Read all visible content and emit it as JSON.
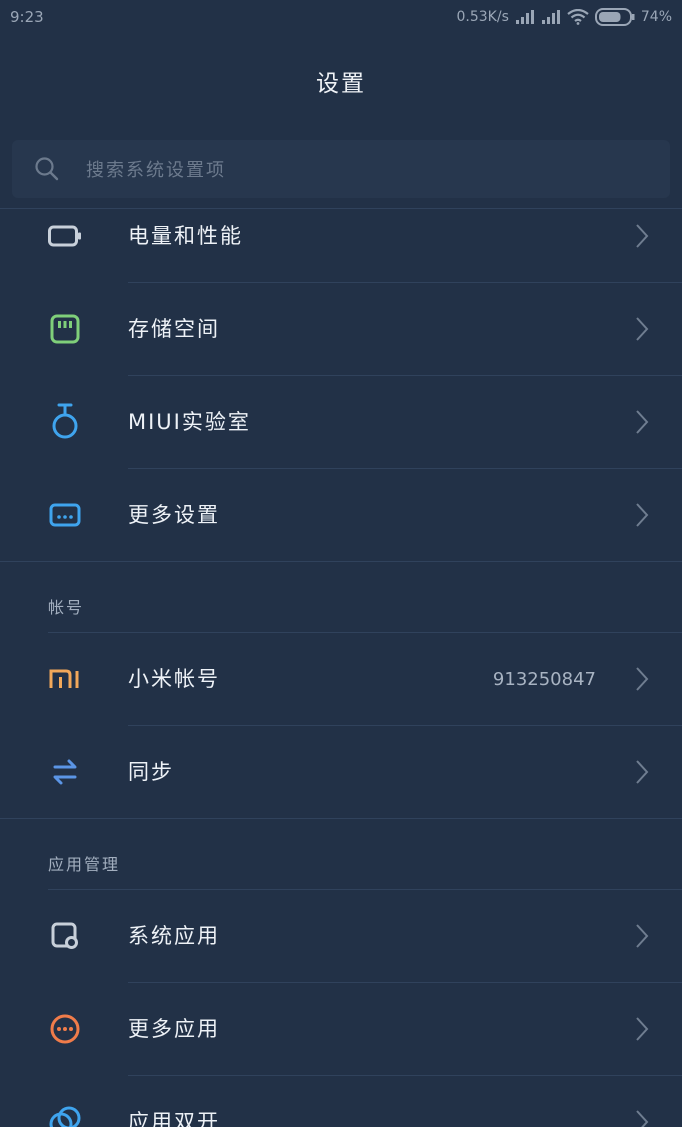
{
  "status_bar": {
    "time": "9:23",
    "network_speed": "0.53K/s",
    "battery": "74%",
    "battery_level": 0.74,
    "icons": [
      "signal-icon",
      "signal-icon",
      "wifi-icon",
      "battery-icon"
    ]
  },
  "header": {
    "title": "设置"
  },
  "search": {
    "placeholder": "搜索系统设置项",
    "value": ""
  },
  "sections": {
    "top": {
      "items": [
        {
          "label": "电量和性能",
          "icon": "battery-icon",
          "color": "#c8d0da"
        },
        {
          "label": "存储空间",
          "icon": "storage-icon",
          "color": "#7fcf7a"
        },
        {
          "label": "MIUI实验室",
          "icon": "flask-icon",
          "color": "#3fa4ee"
        },
        {
          "label": "更多设置",
          "icon": "more-settings-icon",
          "color": "#3fa4ee"
        }
      ]
    },
    "account": {
      "title": "帐号",
      "items": [
        {
          "label": "小米帐号",
          "value": "913250847",
          "icon": "mi-logo-icon",
          "color": "#f2a85a"
        },
        {
          "label": "同步",
          "icon": "sync-icon",
          "color": "#5b95e6"
        }
      ]
    },
    "apps": {
      "title": "应用管理",
      "items": [
        {
          "label": "系统应用",
          "icon": "system-apps-icon",
          "color": "#c8d0da"
        },
        {
          "label": "更多应用",
          "icon": "more-apps-icon",
          "color": "#f07c4a"
        },
        {
          "label": "应用双开",
          "icon": "dual-apps-icon",
          "color": "#3fa4ee"
        }
      ]
    }
  },
  "colors": {
    "background": "#223147",
    "divider": "#30425c",
    "text_primary": "#eef2f7",
    "text_secondary": "#a3afbf"
  }
}
